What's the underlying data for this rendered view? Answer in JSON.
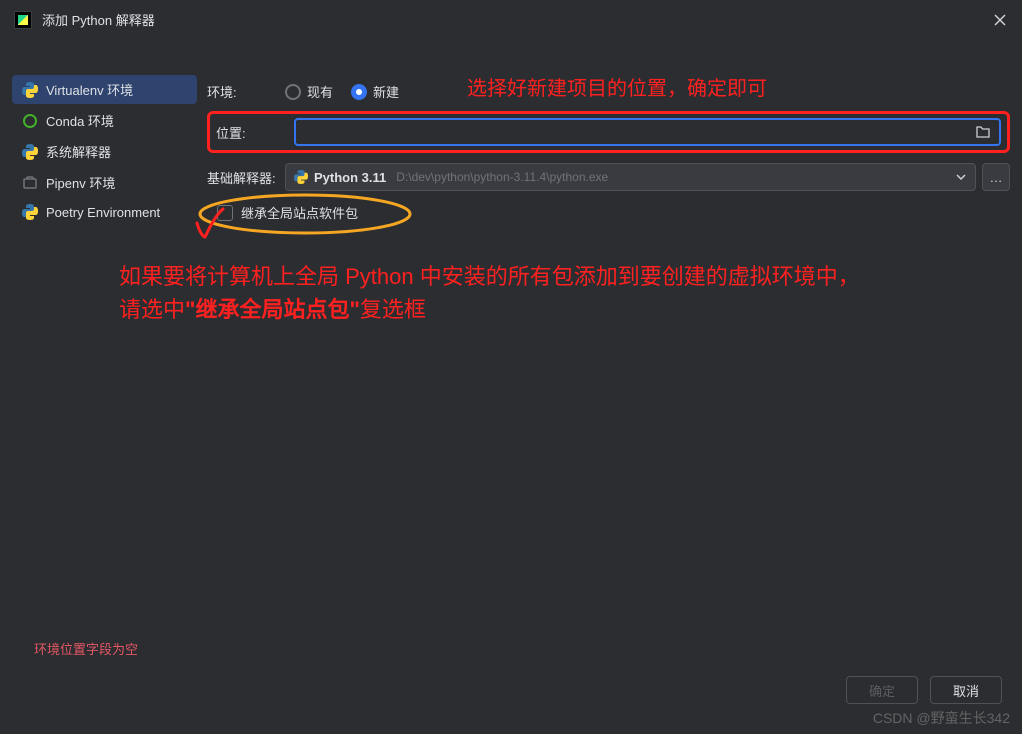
{
  "title": "添加 Python 解释器",
  "sidebar": {
    "items": [
      {
        "label": "Virtualenv 环境"
      },
      {
        "label": "Conda 环境"
      },
      {
        "label": "系统解释器"
      },
      {
        "label": "Pipenv 环境"
      },
      {
        "label": "Poetry Environment"
      }
    ]
  },
  "form": {
    "env_label": "环境:",
    "radio_existing": "现有",
    "radio_new": "新建",
    "location_label": "位置:",
    "base_label": "基础解释器:",
    "base_version": "Python 3.11",
    "base_path": "D:\\dev\\python\\python-3.11.4\\python.exe",
    "inherit_label": "继承全局站点软件包"
  },
  "annotations": {
    "top": "选择好新建项目的位置，确定即可",
    "body_part1": "如果要将计算机上全局 Python 中安装的所有包添加到要创建的虚拟环境中，请选中",
    "body_bold": "\"继承全局站点包\"",
    "body_part2": "复选框"
  },
  "error": "环境位置字段为空",
  "buttons": {
    "ok": "确定",
    "cancel": "取消"
  },
  "watermark": "CSDN @野蛮生长342"
}
